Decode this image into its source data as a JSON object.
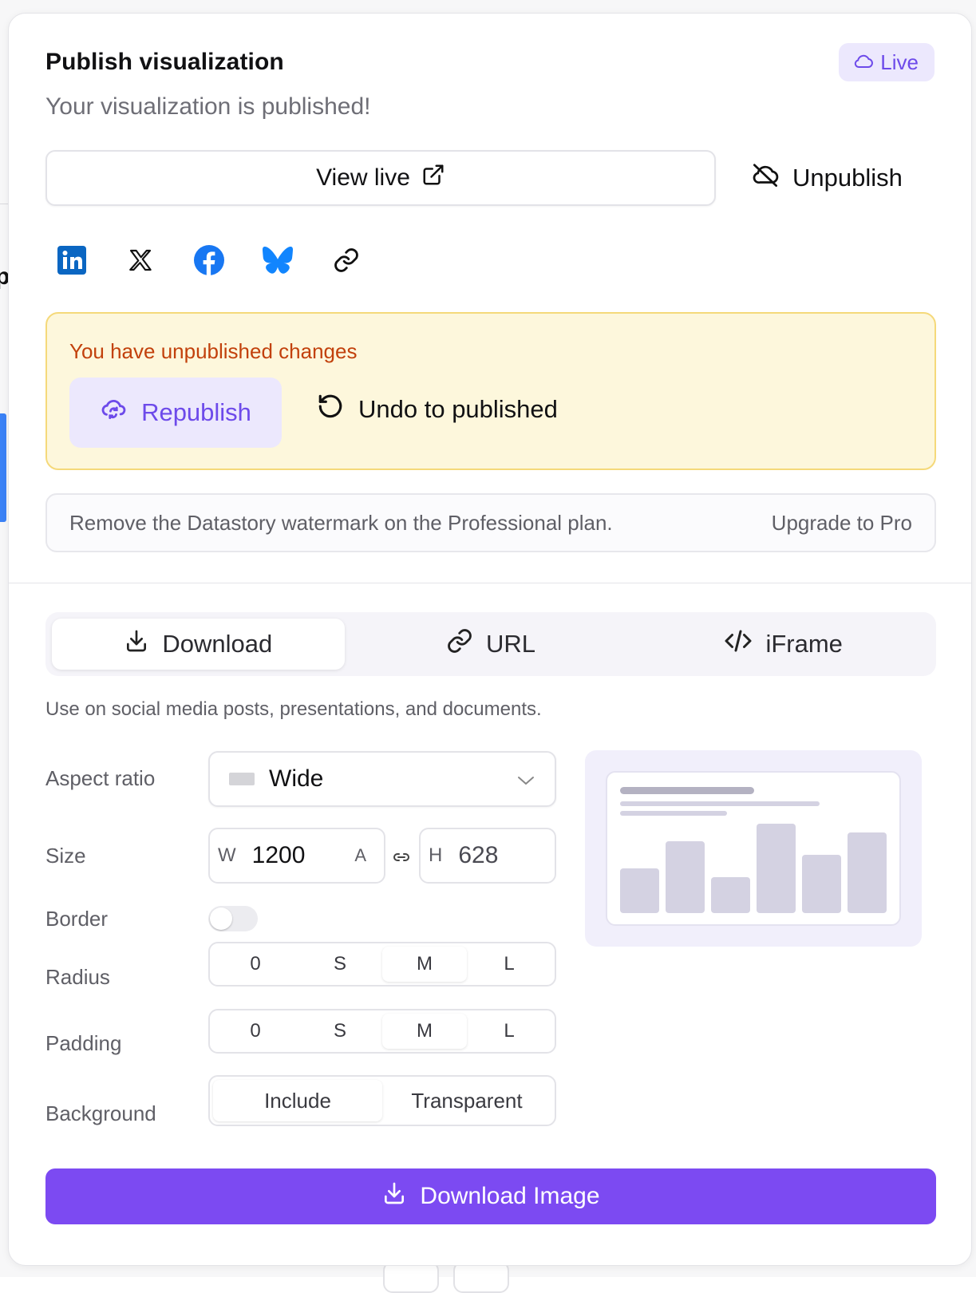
{
  "header": {
    "title": "Publish visualization",
    "subtitle": "Your visualization is published!",
    "status_badge": "Live"
  },
  "actions": {
    "view_live": "View live",
    "unpublish": "Unpublish"
  },
  "share": {
    "icons": [
      "linkedin-icon",
      "x-icon",
      "facebook-icon",
      "bluesky-icon",
      "copy-link-icon"
    ]
  },
  "changes": {
    "message": "You have unpublished changes",
    "republish": "Republish",
    "undo": "Undo to published"
  },
  "watermark": {
    "message": "Remove the Datastory watermark on the Professional plan.",
    "upgrade": "Upgrade to Pro"
  },
  "tabs": [
    {
      "label": "Download",
      "active": true
    },
    {
      "label": "URL",
      "active": false
    },
    {
      "label": "iFrame",
      "active": false
    }
  ],
  "download": {
    "hint": "Use on social media posts, presentations, and documents.",
    "aspect_ratio": {
      "label": "Aspect ratio",
      "value": "Wide"
    },
    "size": {
      "label": "Size",
      "w_prefix": "W",
      "w_value": "1200",
      "w_suffix": "A",
      "h_prefix": "H",
      "h_value": "628"
    },
    "border": {
      "label": "Border",
      "enabled": false
    },
    "radius": {
      "label": "Radius",
      "options": [
        "0",
        "S",
        "M",
        "L"
      ],
      "selected": "M"
    },
    "padding": {
      "label": "Padding",
      "options": [
        "0",
        "S",
        "M",
        "L"
      ],
      "selected": "M"
    },
    "background": {
      "label": "Background",
      "options": [
        "Include",
        "Transparent"
      ],
      "selected": "Include"
    },
    "button": "Download Image"
  },
  "colors": {
    "accent": "#7c4af2",
    "accent_soft": "#ece8fd",
    "warning_text": "#c2410c",
    "warning_bg": "#fdf7dc",
    "linkedin": "#0a66c2",
    "facebook": "#1877f2",
    "bluesky": "#1185fe"
  }
}
